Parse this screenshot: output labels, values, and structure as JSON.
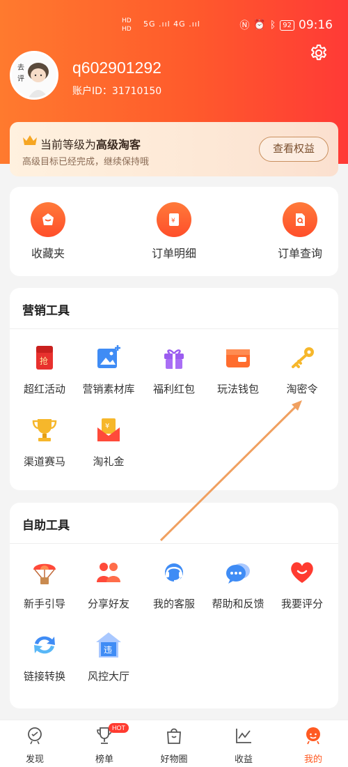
{
  "status_bar": {
    "sim1": "HD",
    "sim2": "HD",
    "network": "5G .ııl 4G .ııl",
    "battery": "92",
    "time": "09:16"
  },
  "profile": {
    "username": "q602901292",
    "account_id": "账户ID：31710150"
  },
  "level_card": {
    "title_prefix": "当前等级为",
    "level_name": "高级淘客",
    "subtitle": "高级目标已经完成，继续保持哦",
    "button_label": "查看权益"
  },
  "quick_actions": [
    {
      "label": "收藏夹",
      "icon": "favorites-icon"
    },
    {
      "label": "订单明细",
      "icon": "order-detail-icon"
    },
    {
      "label": "订单查询",
      "icon": "order-search-icon"
    }
  ],
  "marketing": {
    "title": "营销工具",
    "items": [
      {
        "label": "超红活动",
        "icon": "red-envelope-icon"
      },
      {
        "label": "营销素材库",
        "icon": "image-add-icon"
      },
      {
        "label": "福利红包",
        "icon": "gift-icon"
      },
      {
        "label": "玩法钱包",
        "icon": "wallet-icon"
      },
      {
        "label": "淘密令",
        "icon": "key-icon"
      },
      {
        "label": "渠道赛马",
        "icon": "trophy-icon"
      },
      {
        "label": "淘礼金",
        "icon": "gift-money-icon"
      }
    ]
  },
  "self_service": {
    "title": "自助工具",
    "items": [
      {
        "label": "新手引导",
        "icon": "parachute-icon"
      },
      {
        "label": "分享好友",
        "icon": "friends-icon"
      },
      {
        "label": "我的客服",
        "icon": "headset-icon"
      },
      {
        "label": "帮助和反馈",
        "icon": "chat-bubbles-icon"
      },
      {
        "label": "我要评分",
        "icon": "heart-icon"
      },
      {
        "label": "链接转换",
        "icon": "refresh-icon"
      },
      {
        "label": "风控大厅",
        "icon": "shield-house-icon"
      }
    ]
  },
  "tabs": [
    {
      "label": "发现",
      "icon": "discover-icon"
    },
    {
      "label": "榜单",
      "icon": "trophy-outline-icon",
      "badge": "HOT"
    },
    {
      "label": "好物圈",
      "icon": "bag-icon"
    },
    {
      "label": "收益",
      "icon": "chart-icon"
    },
    {
      "label": "我的",
      "icon": "profile-icon",
      "active": true
    }
  ],
  "colors": {
    "accent": "#ff5a22",
    "header_start": "#ff7a2e",
    "header_end": "#ff3a36",
    "annotation_arrow": "#f0a060"
  }
}
